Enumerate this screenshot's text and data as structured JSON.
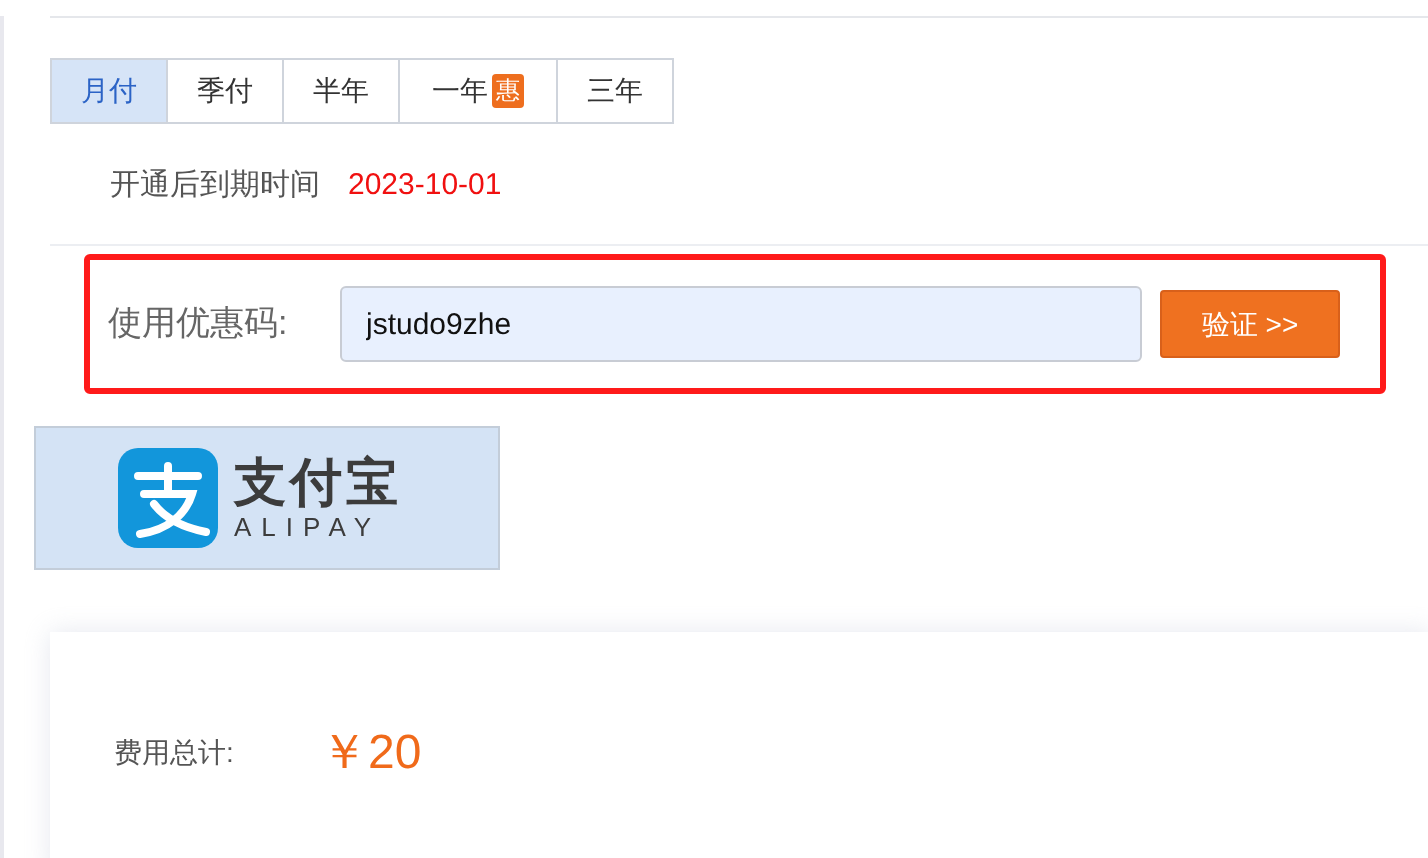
{
  "period_tabs": [
    {
      "label": "月付",
      "selected": true
    },
    {
      "label": "季付",
      "selected": false
    },
    {
      "label": "半年",
      "selected": false
    },
    {
      "label": "一年",
      "selected": false,
      "badge": "惠"
    },
    {
      "label": "三年",
      "selected": false
    }
  ],
  "expiry": {
    "label": "开通后到期时间",
    "date": "2023-10-01"
  },
  "coupon": {
    "label": "使用优惠码:",
    "value": "jstudo9zhe",
    "button": "验证 >>"
  },
  "payment": {
    "name": "支付宝",
    "latin": "ALIPAY",
    "selected": true
  },
  "total": {
    "label": "费用总计:",
    "amount": "￥20"
  }
}
